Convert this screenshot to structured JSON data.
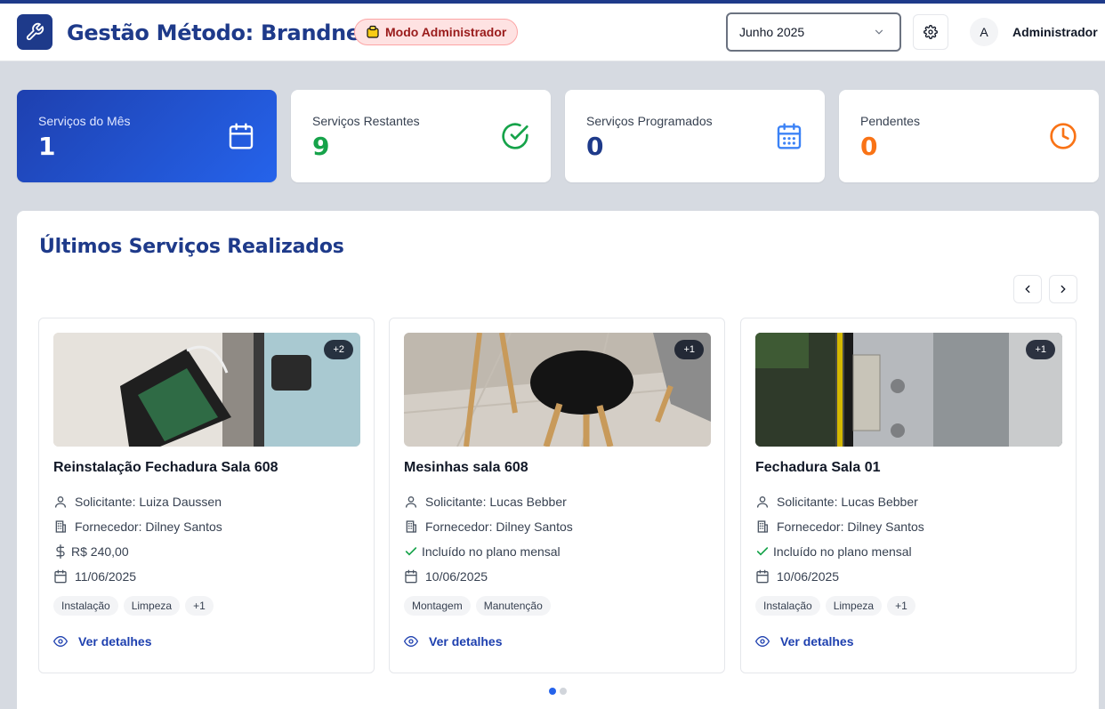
{
  "header": {
    "app_title": "Gestão Método: Brandness",
    "admin_badge": "Modo Administrador",
    "month_selected": "Junho 2025",
    "avatar_initial": "A",
    "user_name": "Administrador"
  },
  "stats": [
    {
      "label": "Serviços do Mês",
      "value": "1",
      "icon": "calendar-icon",
      "color": "#ffffff"
    },
    {
      "label": "Serviços Restantes",
      "value": "9",
      "icon": "check-circle-icon",
      "color": "#16a34a"
    },
    {
      "label": "Serviços Programados",
      "value": "0",
      "icon": "calendar-grid-icon",
      "color": "#1e3a8a"
    },
    {
      "label": "Pendentes",
      "value": "0",
      "icon": "clock-icon",
      "color": "#f97316"
    }
  ],
  "section": {
    "title": "Últimos Serviços Realizados"
  },
  "cards": [
    {
      "photo_badge": "+2",
      "title": "Reinstalação Fechadura Sala 608",
      "requester": "Solicitante: Luiza Daussen",
      "supplier": "Fornecedor: Dilney Santos",
      "price_or_plan": "R$ 240,00",
      "price_icon": "dollar-icon",
      "date": "11/06/2025",
      "tags": [
        "Instalação",
        "Limpeza",
        "+1"
      ],
      "details_label": "Ver detalhes"
    },
    {
      "photo_badge": "+1",
      "title": "Mesinhas sala 608",
      "requester": "Solicitante: Lucas Bebber",
      "supplier": "Fornecedor: Dilney Santos",
      "price_or_plan": "Incluído no plano mensal",
      "price_icon": "check-icon",
      "date": "10/06/2025",
      "tags": [
        "Montagem",
        "Manutenção"
      ],
      "details_label": "Ver detalhes"
    },
    {
      "photo_badge": "+1",
      "title": "Fechadura Sala 01",
      "requester": "Solicitante: Lucas Bebber",
      "supplier": "Fornecedor: Dilney Santos",
      "price_or_plan": "Incluído no plano mensal",
      "price_icon": "check-icon",
      "date": "10/06/2025",
      "tags": [
        "Instalação",
        "Limpeza",
        "+1"
      ],
      "details_label": "Ver detalhes"
    }
  ],
  "pagination": {
    "pages": 2,
    "active": 1
  }
}
